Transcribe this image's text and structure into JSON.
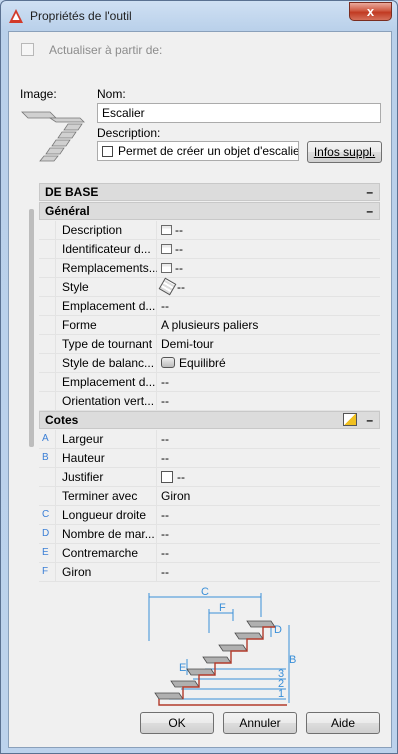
{
  "window": {
    "title": "Propriétés de l'outil",
    "close_label": "x"
  },
  "update": {
    "label": "Actualiser à partir de:"
  },
  "image_label": "Image:",
  "name": {
    "label": "Nom:",
    "value": "Escalier"
  },
  "description": {
    "label": "Description:",
    "value": "Permet de créer un objet d'escalie"
  },
  "more_info_label": "Infos suppl.",
  "sections": {
    "base": "DE BASE",
    "general": "Général",
    "cotes": "Cotes"
  },
  "general_rows": [
    {
      "name": "Description",
      "value": "--",
      "icon": "list-icon"
    },
    {
      "name": "Identificateur d...",
      "value": "--",
      "icon": "list-icon"
    },
    {
      "name": "Remplacements...",
      "value": "--",
      "icon": "list-icon"
    },
    {
      "name": "Style",
      "value": "--",
      "icon": "style-icon"
    },
    {
      "name": "Emplacement d...",
      "value": "--"
    },
    {
      "name": "Forme",
      "value": "A plusieurs paliers"
    },
    {
      "name": "Type de tournant",
      "value": "Demi-tour"
    },
    {
      "name": "Style de balanc...",
      "value": "Equilibré",
      "icon": "balance-icon"
    },
    {
      "name": "Emplacement d...",
      "value": "--"
    },
    {
      "name": "Orientation vert...",
      "value": "--"
    }
  ],
  "cotes_rows": [
    {
      "letter": "A",
      "name": "Largeur",
      "value": "--"
    },
    {
      "letter": "B",
      "name": "Hauteur",
      "value": "--"
    },
    {
      "letter": "",
      "name": "Justifier",
      "value": "--"
    },
    {
      "letter": "",
      "name": "Terminer avec",
      "value": "Giron"
    },
    {
      "letter": "C",
      "name": "Longueur droite",
      "value": "--"
    },
    {
      "letter": "D",
      "name": "Nombre de mar...",
      "value": "--"
    },
    {
      "letter": "E",
      "name": "Contremarche",
      "value": "--"
    },
    {
      "letter": "F",
      "name": "Giron",
      "value": "--"
    }
  ],
  "diagram": {
    "labels": [
      "C",
      "F",
      "D",
      "E",
      "B",
      "1",
      "2",
      "3"
    ]
  },
  "buttons": {
    "ok": "OK",
    "cancel": "Annuler",
    "help": "Aide"
  },
  "colors": {
    "accent_letter": "#3b7fd6",
    "diagram_dim": "#3a8fd8",
    "stair_edge": "#b23a2a"
  }
}
